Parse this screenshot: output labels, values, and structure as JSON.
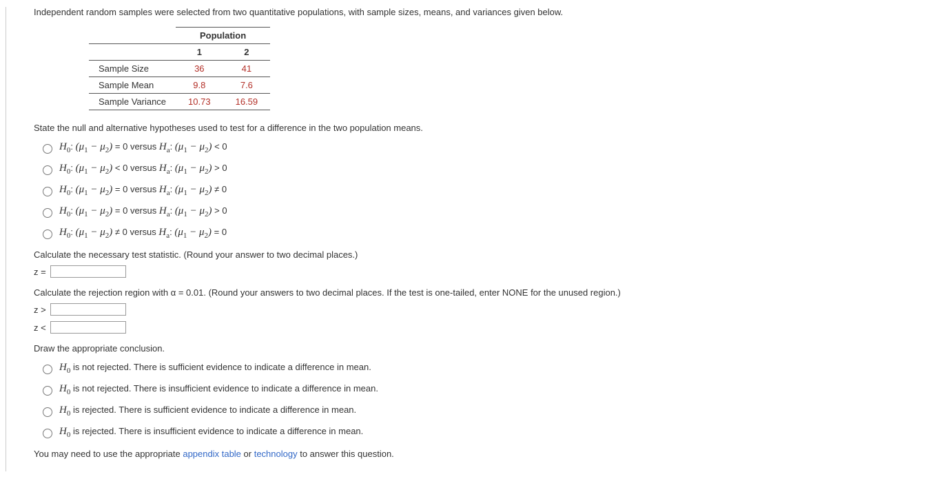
{
  "intro": "Independent random samples were selected from two quantitative populations, with sample sizes, means, and variances given below.",
  "table": {
    "header_span": "Population",
    "col1": "1",
    "col2": "2",
    "rows": [
      {
        "label": "Sample Size",
        "v1": "36",
        "v2": "41"
      },
      {
        "label": "Sample Mean",
        "v1": "9.8",
        "v2": "7.6"
      },
      {
        "label": "Sample Variance",
        "v1": "10.73",
        "v2": "16.59"
      }
    ]
  },
  "q_hypotheses": "State the null and alternative hypotheses used to test for a difference in the two population means.",
  "hyp_options": [
    {
      "h0_rel": "= 0",
      "ha_rel": "< 0"
    },
    {
      "h0_rel": "< 0",
      "ha_rel": "> 0"
    },
    {
      "h0_rel": "= 0",
      "ha_rel": "≠ 0"
    },
    {
      "h0_rel": "= 0",
      "ha_rel": "> 0"
    },
    {
      "h0_rel": "≠ 0",
      "ha_rel": "= 0"
    }
  ],
  "q_teststat": "Calculate the necessary test statistic. (Round your answer to two decimal places.)",
  "teststat_prefix": "z =",
  "q_rejection": "Calculate the rejection region with α = 0.01. (Round your answers to two decimal places. If the test is one-tailed, enter NONE for the unused region.)",
  "rej_gt": "z >",
  "rej_lt": "z <",
  "q_conclusion": "Draw the appropriate conclusion.",
  "conclusion_options": [
    "H₀ is not rejected. There is sufficient evidence to indicate a difference in mean.",
    "H₀ is not rejected. There is insufficient evidence to indicate a difference in mean.",
    "H₀ is rejected. There is sufficient evidence to indicate a difference in mean.",
    "H₀ is rejected. There is insufficient evidence to indicate a difference in mean."
  ],
  "footer_pre": "You may need to use the appropriate ",
  "footer_link1": "appendix table",
  "footer_mid": " or ",
  "footer_link2": "technology",
  "footer_post": " to answer this question.",
  "h0_label": "H",
  "ha_label": "H",
  "sub0": "0",
  "suba": "a",
  "mu_expr_open": "(μ",
  "mu_sub1": "1",
  "mu_minus": " − μ",
  "mu_sub2": "2",
  "mu_expr_close": ")",
  "colon": ": ",
  "versus": " versus "
}
